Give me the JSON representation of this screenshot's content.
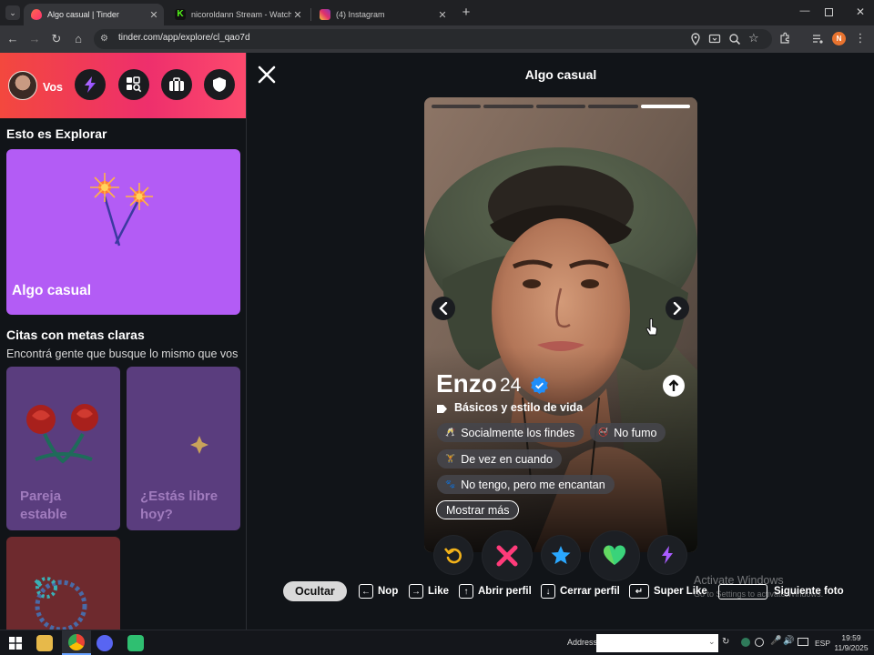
{
  "browser": {
    "tabs": [
      {
        "title": "Algo casual | Tinder",
        "active": true
      },
      {
        "title": "nicoroldann Stream - Watch Li",
        "active": false
      },
      {
        "title": "(4) Instagram",
        "active": false
      }
    ],
    "url": "tinder.com/app/explore/cl_qao7d",
    "profile_initial": "N"
  },
  "sidebar": {
    "user_label": "Vos",
    "section1_title": "Esto es Explorar",
    "card_main": "Algo casual",
    "section2_title": "Citas con metas claras",
    "section2_sub": "Encontrá gente que busque lo mismo que vos",
    "card_pareja": "Pareja\nestable",
    "card_libre": "¿Estás libre\nhoy?"
  },
  "main": {
    "title": "Algo casual",
    "name": "Enzo",
    "age": "24",
    "section_label": "Básicos y estilo de vida",
    "chips": [
      "Socialmente los findes",
      "No fumo",
      "De vez en cuando",
      "No tengo, pero me encantan"
    ],
    "show_more": "Mostrar más",
    "photo_count": 5,
    "photo_index": 5
  },
  "shortcuts": {
    "hide": "Ocultar",
    "nope": "Nop",
    "like": "Like",
    "open_profile": "Abrir perfil",
    "close_profile": "Cerrar perfil",
    "super_like": "Super Like",
    "next_photo": "Siguiente foto"
  },
  "watermark": {
    "line1": "Activate Windows",
    "line2": "Go to Settings to activate Windows."
  },
  "taskbar": {
    "address_label": "Address",
    "lang": "ESP",
    "time": "19:59",
    "date": "11/9/2025"
  },
  "colors": {
    "brand_gradient_start": "#f3483e",
    "brand_gradient_end": "#fd4a6d",
    "nope": "#ff3b7a",
    "like": "#3ad37a",
    "super_like": "#2aa8ff",
    "boost": "#a95cff",
    "rewind": "#f2b21a",
    "card_purple": "#b35cf5",
    "card_muted": "#6b3d8e"
  }
}
